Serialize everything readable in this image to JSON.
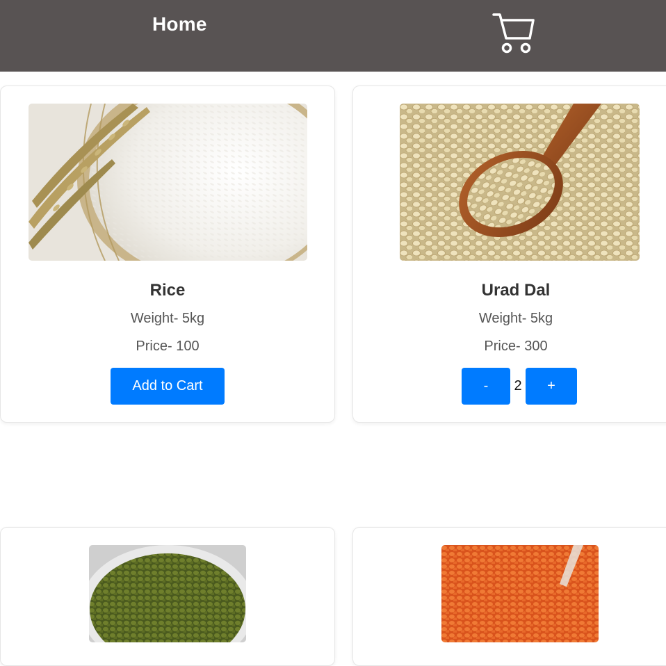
{
  "navbar": {
    "home_label": "Home",
    "cart_icon": "shopping-cart-icon",
    "background_color": "#585353"
  },
  "accent_color": "#007bff",
  "products": [
    {
      "name": "Rice",
      "weight": "Weight- 5kg",
      "price": "Price- 100",
      "button_label": "Add to Cart",
      "image": "rice-image"
    },
    {
      "name": "Urad Dal",
      "weight": "Weight- 5kg",
      "price": "Price- 300",
      "decrement_label": "-",
      "quantity": "2",
      "increment_label": "+",
      "image": "urad-dal-image"
    },
    {
      "image": "moong-dal-image"
    },
    {
      "image": "masoor-dal-image"
    }
  ]
}
